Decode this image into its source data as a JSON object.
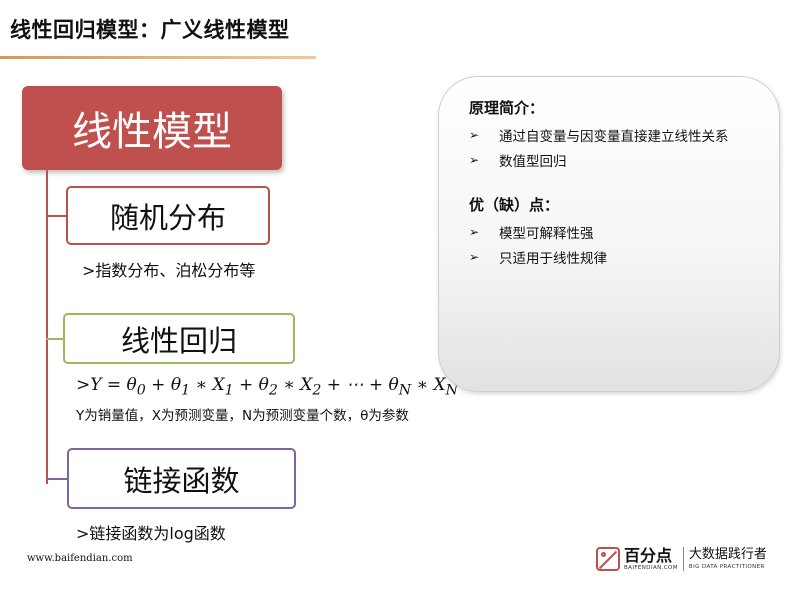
{
  "slide": {
    "title": "线性回归模型：广义线性模型"
  },
  "tree": {
    "root_label": "线性模型",
    "nodes": [
      {
        "label": "随机分布",
        "note": ">指数分布、泊松分布等"
      },
      {
        "label": "线性回归",
        "formula": ">Y = θ₀ + θ₁ * X₁ + θ₂ * X₂ + ⋯ + θ_N * X_N",
        "description": "Y为销量值，X为预测变量，N为预测变量个数，θ为参数"
      },
      {
        "label": "链接函数",
        "note": ">链接函数为log函数"
      }
    ]
  },
  "info_card": {
    "principle_heading": "原理简介：",
    "principle_items": [
      "通过自变量与因变量直接建立线性关系",
      "数值型回归"
    ],
    "pros_cons_heading": "优（缺）点：",
    "pros_cons_items": [
      "模型可解释性强",
      "只适用于线性规律"
    ],
    "bullet_glyph": "➢"
  },
  "footer": {
    "url": "www.baifendian.com",
    "brand_name": "百分点",
    "brand_sub": "BAIFENDIAN.COM",
    "slogan": "大数据践行者",
    "slogan_sub": "BIG DATA PRACTITIONER"
  },
  "colors": {
    "root": "#c0504d",
    "node_1_border": "#c0504d",
    "node_2_border": "#9bbb59",
    "node_3_border": "#8064a2",
    "title_rule": "#d39a55"
  }
}
